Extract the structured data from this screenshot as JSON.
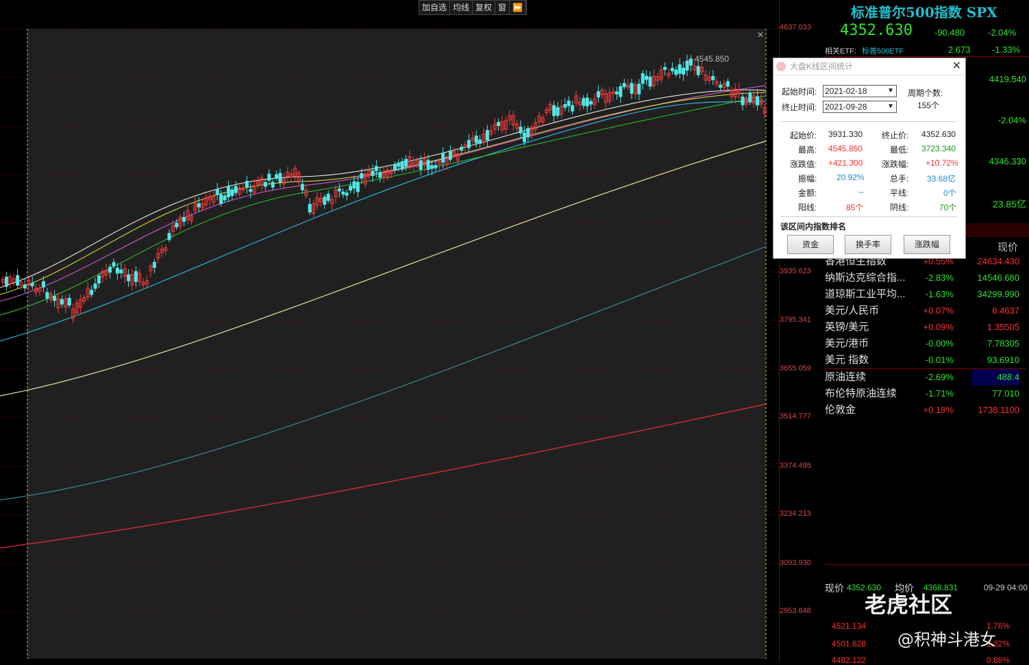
{
  "toolbar": {
    "items": [
      "加自选",
      "均线",
      "复权",
      "窗",
      "⏩"
    ]
  },
  "chart": {
    "peak_label": "4545.850",
    "price_ticks": [
      "4637.033",
      "3935.623",
      "3795.341",
      "3655.059",
      "3514.777",
      "3374.495",
      "3234.213",
      "3093.930",
      "2953.648"
    ]
  },
  "panel": {
    "title": "标准普尔500指数 SPX",
    "price": "4352.630",
    "change": "-90.480",
    "change_pct": "-2.04%",
    "etf_label": "相关ETF:",
    "etf_name": "标普500ETF",
    "etf_price": "2.673",
    "etf_pct": "-1.33%",
    "side_values": [
      "4419.540",
      "-2.04%",
      "4346.330",
      "23.85亿"
    ],
    "list_header": "现价",
    "list": [
      {
        "name": "香港恒生指数",
        "pct": "+0.55%",
        "val": "24634.430"
      },
      {
        "name": "纳斯达克综合指...",
        "pct": "-2.83%",
        "val": "14546.680"
      },
      {
        "name": "道琼斯工业平均...",
        "pct": "-1.63%",
        "val": "34299.990"
      },
      {
        "name": "美元/人民币",
        "pct": "+0.07%",
        "val": "6.4637"
      },
      {
        "name": "英镑/美元",
        "pct": "+0.09%",
        "val": "1.35505"
      },
      {
        "name": "美元/港币",
        "pct": "-0.00%",
        "val": "7.78305"
      },
      {
        "name": "美元 指数",
        "pct": "-0.01%",
        "val": "93.6910"
      },
      {
        "name": "原油连续",
        "pct": "-2.69%",
        "val": "488.4"
      },
      {
        "name": "布伦特原油连续",
        "pct": "-1.71%",
        "val": "77.010"
      },
      {
        "name": "伦敦金",
        "pct": "+0.18%",
        "val": "1738.1100"
      }
    ],
    "bottom": {
      "now_label": "现价",
      "now_val": "4352.630",
      "avg_label": "均价",
      "avg_val": "4368.831",
      "time": "09-29 04:00",
      "rows": [
        {
          "p": "4521.134",
          "pct": "1.76%"
        },
        {
          "p": "4501.628",
          "pct": "1.32%"
        },
        {
          "p": "4482.122",
          "pct": "0.88%"
        }
      ]
    }
  },
  "popup": {
    "title": "大盘K线区间统计",
    "start_label": "起始时间:",
    "start": "2021-02-18",
    "end_label": "终止时间:",
    "end": "2021-09-28",
    "periods_label": "周期个数:",
    "periods": "155个",
    "stats": {
      "start_price_l": "起始价:",
      "start_price": "3931.330",
      "end_price_l": "终止价:",
      "end_price": "4352.630",
      "high_l": "最高:",
      "high": "4545.850",
      "low_l": "最低:",
      "low": "3723.340",
      "chg_l": "涨跌值:",
      "chg": "+421.300",
      "chg_pct_l": "涨跌幅:",
      "chg_pct": "+10.72%",
      "amp_l": "振幅:",
      "amp": "20.92%",
      "vol_l": "总手:",
      "vol": "33.68亿",
      "amt_l": "金额:",
      "amt": "--",
      "flat_l": "平线:",
      "flat": "0个",
      "up_l": "阳线:",
      "up": "85个",
      "down_l": "阴线:",
      "down": "70个"
    },
    "rank_title": "该区间内指数排名",
    "buttons": [
      "资金",
      "换手率",
      "涨跌幅"
    ]
  },
  "watermark": {
    "brand": "老虎社区",
    "author": "@积神斗港女"
  }
}
